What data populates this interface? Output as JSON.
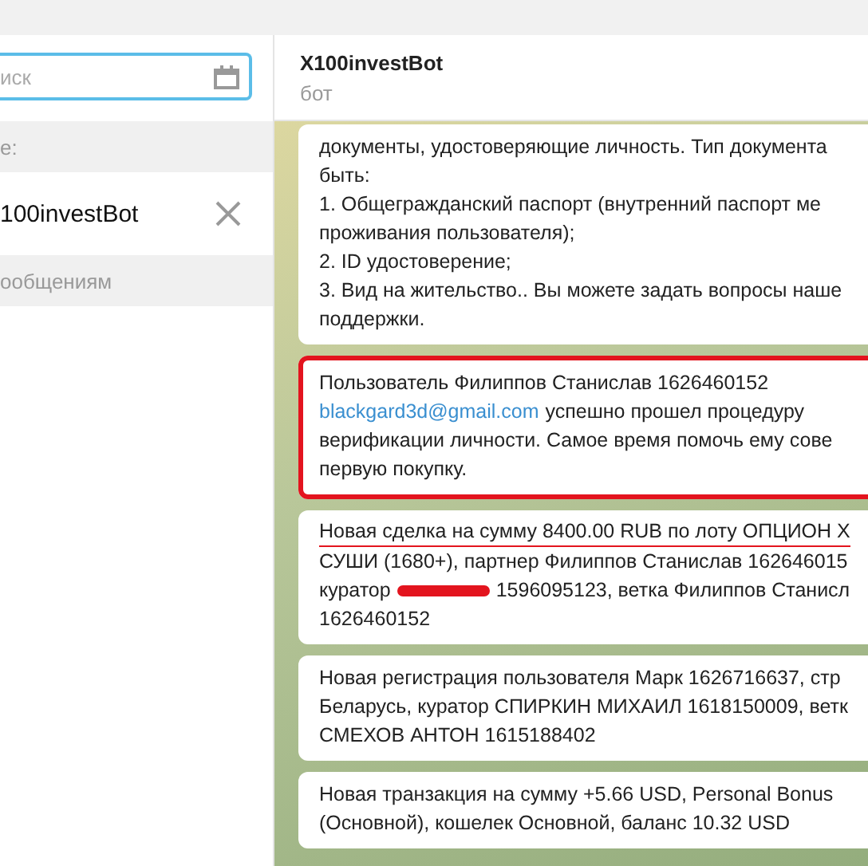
{
  "sidebar": {
    "search": {
      "placeholder": "иск"
    },
    "section_label": "е:",
    "result": {
      "name": "100investBot"
    },
    "messages_label": "ообщениям"
  },
  "chat": {
    "title": "X100investBot",
    "subtitle": "бот",
    "messages": [
      {
        "highlighted": false,
        "lines": [
          {
            "underlined": false,
            "parts": [
              {
                "kind": "text",
                "text": "документы, удостоверяющие личность. Тип документа"
              }
            ]
          },
          {
            "underlined": false,
            "parts": [
              {
                "kind": "text",
                "text": "быть:"
              }
            ]
          },
          {
            "underlined": false,
            "parts": [
              {
                "kind": "text",
                "text": "1. Общегражданский паспорт (внутренний паспорт ме"
              }
            ]
          },
          {
            "underlined": false,
            "parts": [
              {
                "kind": "text",
                "text": "проживания пользователя);"
              }
            ]
          },
          {
            "underlined": false,
            "parts": [
              {
                "kind": "text",
                "text": "2. ID удостоверение;"
              }
            ]
          },
          {
            "underlined": false,
            "parts": [
              {
                "kind": "text",
                "text": "3. Вид на жительство.. Вы можете задать вопросы наше"
              }
            ]
          },
          {
            "underlined": false,
            "parts": [
              {
                "kind": "text",
                "text": "поддержки."
              }
            ]
          }
        ]
      },
      {
        "highlighted": true,
        "lines": [
          {
            "underlined": false,
            "parts": [
              {
                "kind": "text",
                "text": "Пользователь Филиппов Станислав 1626460152"
              }
            ]
          },
          {
            "underlined": false,
            "parts": [
              {
                "kind": "link",
                "text": "blackgard3d@gmail.com"
              },
              {
                "kind": "text",
                "text": "успешно прошел процедуру"
              }
            ]
          },
          {
            "underlined": false,
            "parts": [
              {
                "kind": "text",
                "text": "верификации личности. Самое время помочь ему сове"
              }
            ]
          },
          {
            "underlined": false,
            "parts": [
              {
                "kind": "text",
                "text": "первую покупку."
              }
            ]
          }
        ]
      },
      {
        "highlighted": false,
        "lines": [
          {
            "underlined": true,
            "parts": [
              {
                "kind": "text",
                "text": "Новая сделка на сумму 8400.00 RUB по лоту ОПЦИОН X"
              }
            ]
          },
          {
            "underlined": false,
            "parts": [
              {
                "kind": "text",
                "text": "СУШИ (1680+), партнер Филиппов Станислав 162646015"
              }
            ]
          },
          {
            "underlined": false,
            "parts": [
              {
                "kind": "text",
                "text": "куратор"
              },
              {
                "kind": "redaction"
              },
              {
                "kind": "text",
                "text": "1596095123, ветка Филиппов Станисл"
              }
            ]
          },
          {
            "underlined": false,
            "parts": [
              {
                "kind": "text",
                "text": "1626460152"
              }
            ]
          }
        ]
      },
      {
        "highlighted": false,
        "lines": [
          {
            "underlined": false,
            "parts": [
              {
                "kind": "text",
                "text": "Новая регистрация пользователя  Марк 1626716637, стр"
              }
            ]
          },
          {
            "underlined": false,
            "parts": [
              {
                "kind": "text",
                "text": "Беларусь, куратор СПИРКИН МИХАИЛ 1618150009, ветк"
              }
            ]
          },
          {
            "underlined": false,
            "parts": [
              {
                "kind": "text",
                "text": "СМЕХОВ АНТОН 1615188402"
              }
            ]
          }
        ]
      },
      {
        "highlighted": false,
        "lines": [
          {
            "underlined": false,
            "parts": [
              {
                "kind": "text",
                "text": "Новая транзакция на сумму +5.66 USD, Personal Bonus"
              }
            ]
          },
          {
            "underlined": false,
            "parts": [
              {
                "kind": "text",
                "text": "(Основной), кошелек Основной, баланс 10.32 USD"
              }
            ]
          }
        ]
      }
    ]
  }
}
